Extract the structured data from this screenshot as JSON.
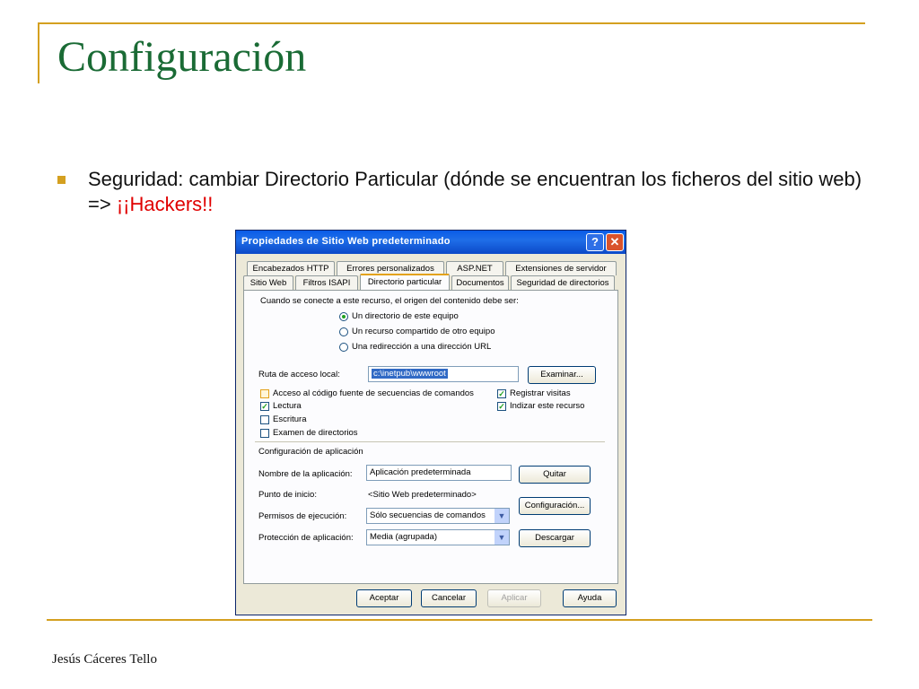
{
  "slide": {
    "title": "Configuración",
    "bullet_text": "Seguridad: cambiar Directorio Particular (dónde se encuentran los ficheros del sitio web) => ",
    "bullet_highlight": "¡¡Hackers!!",
    "footer": "Jesús Cáceres Tello",
    "accent_color": "#d4a020",
    "title_color": "#1a6b35",
    "highlight_color": "#e00000"
  },
  "dialog": {
    "title": "Propiedades de Sitio Web predeterminado",
    "help_label": "?",
    "close_label": "✕",
    "tabs_row1": [
      "Encabezados HTTP",
      "Errores personalizados",
      "ASP.NET",
      "Extensiones de servidor"
    ],
    "tabs_row2": [
      "Sitio Web",
      "Filtros ISAPI",
      "Directorio particular",
      "Documentos",
      "Seguridad de directorios"
    ],
    "active_tab": "Directorio particular",
    "connect_label": "Cuando se conecte a este recurso, el origen del contenido debe ser:",
    "radios": [
      {
        "label": "Un directorio de este equipo",
        "checked": true
      },
      {
        "label": "Un recurso compartido de otro equipo",
        "checked": false
      },
      {
        "label": "Una redirección a una dirección URL",
        "checked": false
      }
    ],
    "path_label": "Ruta de acceso local:",
    "path_value": "c:\\inetpub\\wwwroot",
    "browse_label": "Examinar...",
    "checks_left": [
      {
        "label": "Acceso al código fuente de secuencias de comandos",
        "checked": false
      },
      {
        "label": "Lectura",
        "checked": true
      },
      {
        "label": "Escritura",
        "checked": false
      },
      {
        "label": "Examen de directorios",
        "checked": false
      }
    ],
    "checks_right": [
      {
        "label": "Registrar visitas",
        "checked": true
      },
      {
        "label": "Indizar este recurso",
        "checked": true
      }
    ],
    "app_section": "Configuración de aplicación",
    "app_name_label": "Nombre de la aplicación:",
    "app_name_value": "Aplicación predeterminada",
    "remove_label": "Quitar",
    "start_label": "Punto de inicio:",
    "start_value": "<Sitio Web predeterminado>",
    "config_label": "Configuración...",
    "exec_label": "Permisos de ejecución:",
    "exec_value": "Sólo secuencias de comandos",
    "protect_label": "Protección de aplicación:",
    "protect_value": "Media (agrupada)",
    "unload_label": "Descargar",
    "ok_label": "Aceptar",
    "cancel_label": "Cancelar",
    "apply_label": "Aplicar",
    "help_button_label": "Ayuda",
    "dropdown_glyph": "▼",
    "check_glyph": "✓"
  }
}
